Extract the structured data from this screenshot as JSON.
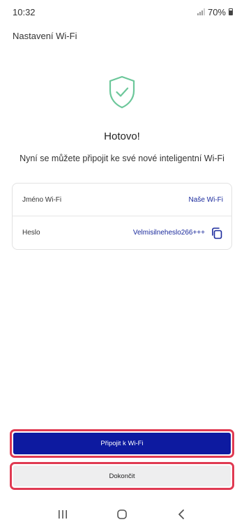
{
  "status_bar": {
    "time": "10:32",
    "battery": "70%"
  },
  "header": {
    "title": "Nastavení Wi-Fi"
  },
  "main": {
    "icon": "shield-check-icon",
    "title": "Hotovo!",
    "subtitle": "Nyní se můžete připojit ke své nové inteligentní Wi-Fi"
  },
  "wifi_card": {
    "name_label": "Jméno Wi-Fi",
    "name_value": "Naše Wi-Fi",
    "password_label": "Heslo",
    "password_value": "Velmisilneheslo266+++"
  },
  "buttons": {
    "connect_label": "Připojit k Wi-Fi",
    "finish_label": "Dokončit"
  },
  "colors": {
    "primary": "#0d1aa0",
    "link": "#1a2a9c",
    "shield": "#6cc79a",
    "highlight": "#e03a52"
  },
  "nav": {
    "icons": [
      "recent-apps-icon",
      "home-icon",
      "back-icon"
    ]
  }
}
